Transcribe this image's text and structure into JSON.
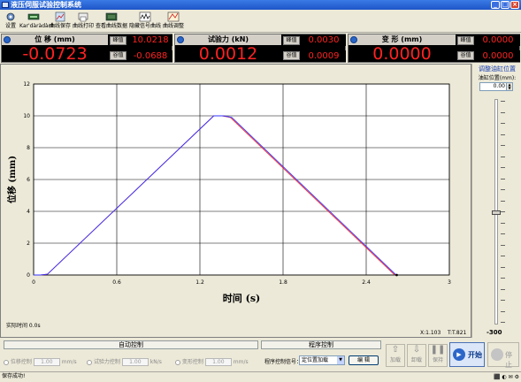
{
  "window": {
    "title": "液压伺服试验控制系统"
  },
  "toolbar": {
    "items": [
      {
        "label": "设置",
        "icon": "settings-icon"
      },
      {
        "label": "Kar'dàràdàrè",
        "icon": "calibration-icon"
      },
      {
        "label": "曲线保存",
        "icon": "save-curve-icon"
      },
      {
        "label": "曲线打印",
        "icon": "print-icon"
      },
      {
        "label": "查看曲线数据",
        "icon": "view-data-icon"
      },
      {
        "label": "隐藏信号曲线",
        "icon": "hide-curve-icon"
      },
      {
        "label": "曲线调整",
        "icon": "adjust-curve-icon"
      }
    ]
  },
  "readouts": {
    "displacement": {
      "title": "位 移 (mm)",
      "value": "-0.0723",
      "peak_label": "峰值",
      "peak": "10.0218",
      "valley_label": "谷值",
      "valley": "-0.0688"
    },
    "force": {
      "title": "试验力 (kN)",
      "value": "0.0012",
      "peak_label": "峰值",
      "peak": "0.0030",
      "valley_label": "谷值",
      "valley": "0.0009"
    },
    "deformation": {
      "title": "变 形 (mm)",
      "value": "0.0000",
      "peak_label": "峰值",
      "peak": "0.0000",
      "valley_label": "谷值",
      "valley": "0.0000"
    }
  },
  "chart_data": {
    "type": "line",
    "xlabel": "时间 (s)",
    "ylabel": "位移 (mm)",
    "xlim": [
      0,
      3
    ],
    "ylim": [
      0,
      12
    ],
    "xticks": [
      "0",
      "0.6",
      "1.2",
      "1.8",
      "2.4",
      "3"
    ],
    "yticks": [
      "0",
      "2",
      "4",
      "6",
      "8",
      "10",
      "12"
    ],
    "grid": true,
    "series": [
      {
        "color": "#ff2020",
        "x": [
          0,
          0.05,
          0.1,
          1.3,
          1.36,
          1.42,
          2.6,
          2.62
        ],
        "y": [
          0,
          0,
          0.05,
          10.0,
          10.0,
          9.9,
          0.05,
          0.0
        ]
      },
      {
        "color": "#3333ff",
        "x": [
          0,
          0.05,
          0.1,
          1.3,
          1.37,
          1.43,
          2.61,
          2.62
        ],
        "y": [
          0,
          0,
          0.05,
          10.0,
          10.0,
          9.9,
          0.05,
          0.0
        ]
      }
    ]
  },
  "plot_info": {
    "realtime": "实际时间 0.0s",
    "x_readout": "X:1.103",
    "t_readout": "T:T.821"
  },
  "right_panel": {
    "title": "调整油缸位置",
    "label": "油缸位置(mm):",
    "value": "0.00",
    "min_label": "-300"
  },
  "control": {
    "tab_auto": "自动控制",
    "tab_program": "程序控制",
    "disp_ctrl_label": "位移控制",
    "disp_ctrl_value": "1.00",
    "disp_ctrl_unit": "mm/s",
    "force_ctrl_label": "试验力控制",
    "force_ctrl_value": "1.00",
    "force_ctrl_unit": "kN/s",
    "deform_ctrl_label": "变形控制",
    "deform_ctrl_value": "1.00",
    "deform_ctrl_unit": "mm/s",
    "program_signal_label": "程序控制信号：",
    "program_signal_value": "定位置加载",
    "edit_label": "编 辑",
    "load_label": "加载",
    "unload_label": "卸载",
    "hold_label": "保持",
    "start_label": "开始",
    "stop_label": "停止"
  },
  "status": {
    "text": "保存成功!"
  }
}
